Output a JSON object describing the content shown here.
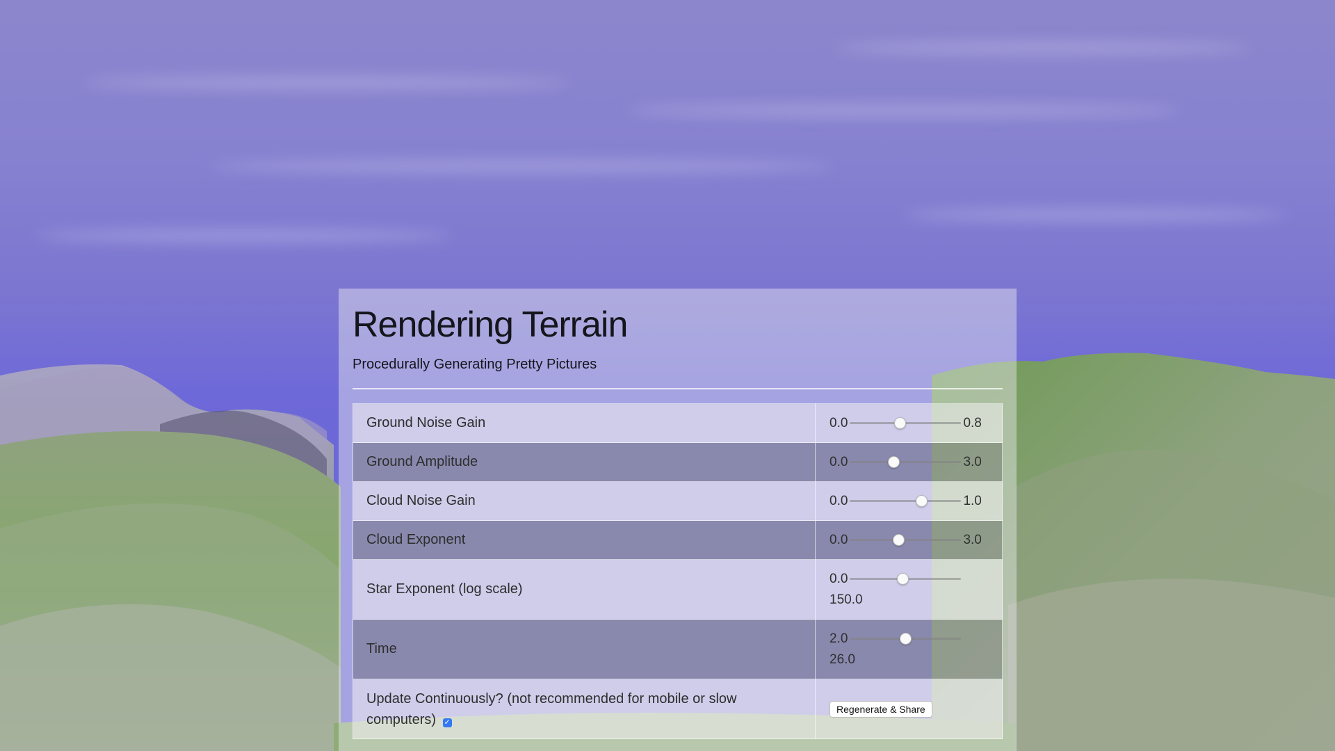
{
  "header": {
    "title": "Rendering Terrain",
    "subtitle": "Procedurally Generating Pretty Pictures"
  },
  "controls": [
    {
      "label": "Ground Noise Gain",
      "min": "0.0",
      "max": "0.8",
      "value_fraction": 0.44
    },
    {
      "label": "Ground Amplitude",
      "min": "0.0",
      "max": "3.0",
      "value_fraction": 0.38
    },
    {
      "label": "Cloud Noise Gain",
      "min": "0.0",
      "max": "1.0",
      "value_fraction": 0.66
    },
    {
      "label": "Cloud Exponent",
      "min": "0.0",
      "max": "3.0",
      "value_fraction": 0.43
    },
    {
      "label": "Star Exponent (log scale)",
      "min": "0.0",
      "max": "150.0",
      "value_fraction": 0.47
    },
    {
      "label": "Time",
      "min": "2.0",
      "max": "26.0",
      "value_fraction": 0.5
    }
  ],
  "update": {
    "label": "Update Continuously? (not recommended for mobile or slow computers)",
    "checked": true,
    "check_glyph": "✓",
    "button_label": "Regenerate & Share"
  },
  "colors": {
    "sky": "#7b75d1",
    "grass": "#7a9c62",
    "checkbox": "#3478f6"
  }
}
